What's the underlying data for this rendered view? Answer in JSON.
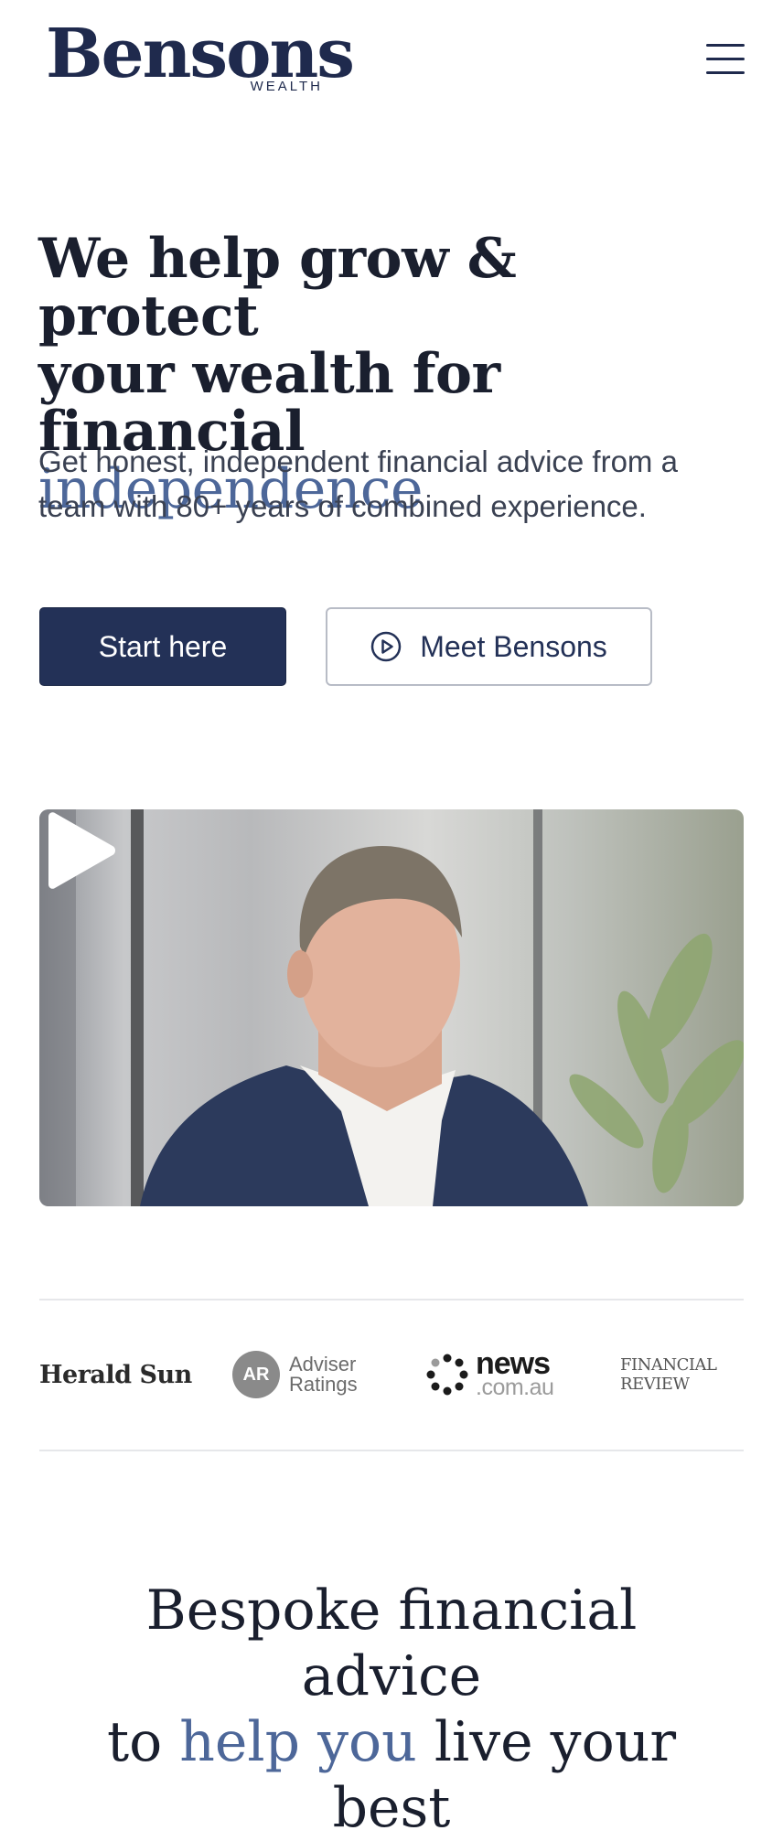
{
  "header": {
    "logo_word": "Bensons",
    "logo_sub": "WEALTH",
    "menu_icon": "hamburger-menu-icon"
  },
  "hero": {
    "title_line1": "We help grow & protect",
    "title_line2": "your wealth for financial",
    "title_highlight": "independence",
    "subtitle": "Get honest, independent financial advice from a team with 80+ years of combined experience.",
    "primary_button": "Start here",
    "secondary_button": "Meet Bensons",
    "secondary_icon": "play-circle-icon"
  },
  "video": {
    "play_icon": "play-icon"
  },
  "press": {
    "herald_sun": "Herald Sun",
    "adviser_badge": "AR",
    "adviser_line1": "Adviser",
    "adviser_line2": "Ratings",
    "news_main": "news",
    "news_sub": ".com.au",
    "financial_review": "FINANCIAL REVIEW"
  },
  "section": {
    "heading_start": "Bespoke financial advice",
    "heading_to": "to",
    "heading_highlight": "help you",
    "heading_end": "live your best"
  },
  "colors": {
    "navy": "#233157",
    "accent_blue": "#4d6799",
    "text_dark": "#1a1f2e"
  }
}
